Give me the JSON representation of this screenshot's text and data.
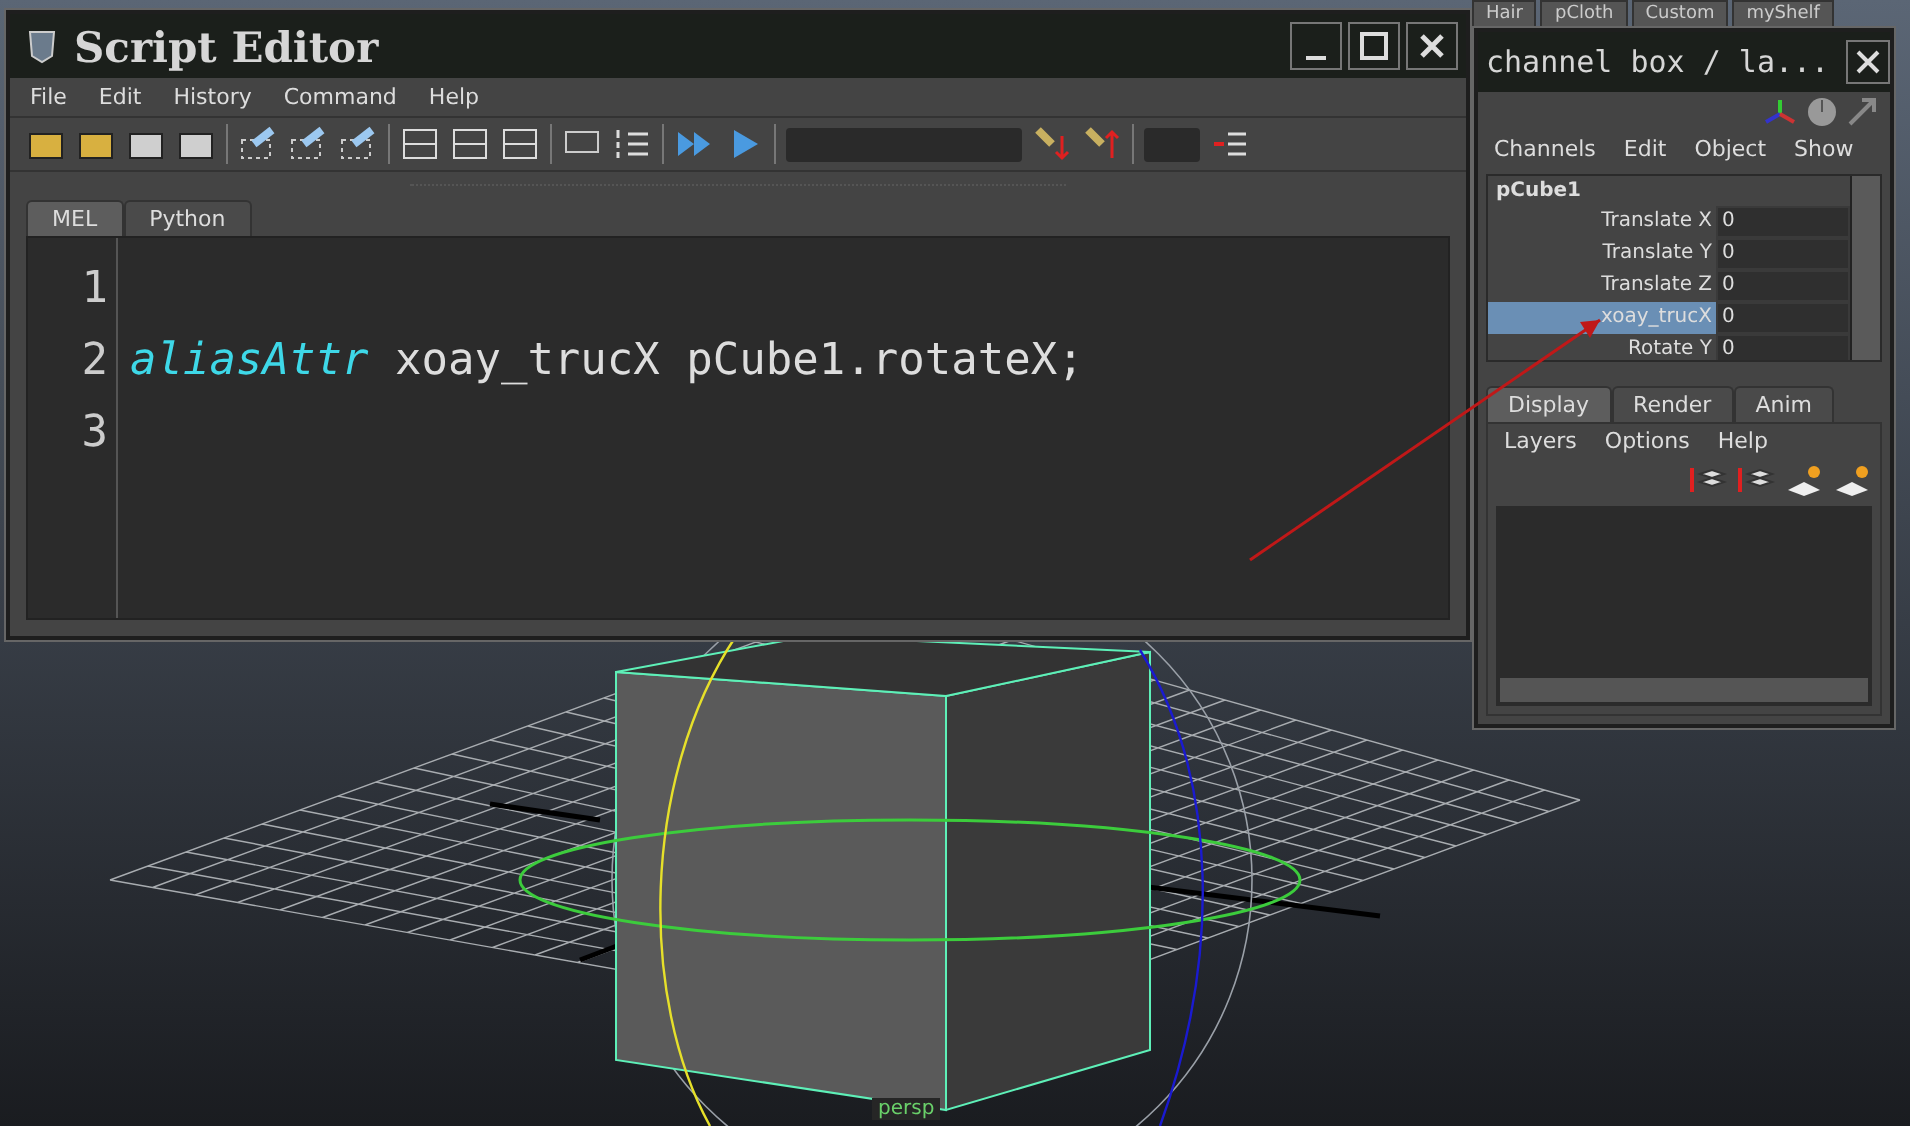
{
  "shelf_tabs": [
    {
      "label": "Hair"
    },
    {
      "label": "pCloth"
    },
    {
      "label": "Custom"
    },
    {
      "label": "myShelf"
    }
  ],
  "script_editor": {
    "title": "Script Editor",
    "menu": [
      "File",
      "Edit",
      "History",
      "Command",
      "Help"
    ],
    "tabs": [
      {
        "label": "MEL",
        "selected": true
      },
      {
        "label": "Python",
        "selected": false
      }
    ],
    "lines": [
      {
        "number": "1"
      },
      {
        "number": "2",
        "tokens": [
          {
            "kind": "keyword",
            "text": "aliasAttr"
          },
          {
            "kind": "plain",
            "text": " xoay_trucX pCube1.rotateX;"
          }
        ]
      },
      {
        "number": "3"
      }
    ]
  },
  "channel_box": {
    "title": "channel box / la...",
    "menu": [
      "Channels",
      "Edit",
      "Object",
      "Show"
    ],
    "object": "pCube1",
    "channels": [
      {
        "name": "Translate X",
        "value": "0",
        "selected": false
      },
      {
        "name": "Translate Y",
        "value": "0",
        "selected": false
      },
      {
        "name": "Translate Z",
        "value": "0",
        "selected": false
      },
      {
        "name": "xoay_trucX",
        "value": "0",
        "selected": true
      },
      {
        "name": "Rotate Y",
        "value": "0",
        "selected": false
      }
    ],
    "layer_tabs": [
      {
        "label": "Display",
        "selected": true
      },
      {
        "label": "Render",
        "selected": false
      },
      {
        "label": "Anim",
        "selected": false
      }
    ],
    "layer_menu": [
      "Layers",
      "Options",
      "Help"
    ]
  },
  "viewport": {
    "camera_label": "persp"
  }
}
